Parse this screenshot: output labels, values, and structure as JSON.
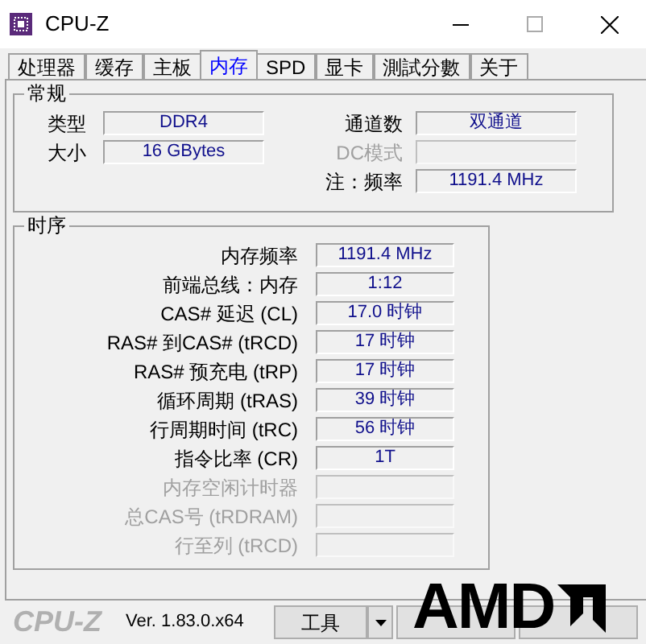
{
  "window": {
    "title": "CPU-Z"
  },
  "tabs": [
    {
      "label": "处理器",
      "selected": false
    },
    {
      "label": "缓存",
      "selected": false
    },
    {
      "label": "主板",
      "selected": false
    },
    {
      "label": "内存",
      "selected": true
    },
    {
      "label": "SPD",
      "selected": false
    },
    {
      "label": "显卡",
      "selected": false
    },
    {
      "label": "測試分數",
      "selected": false
    },
    {
      "label": "关于",
      "selected": false
    }
  ],
  "general": {
    "title": "常规",
    "left": [
      {
        "label": "类型",
        "value": "DDR4",
        "disabled": false
      },
      {
        "label": "大小",
        "value": "16 GBytes",
        "disabled": false
      }
    ],
    "right": [
      {
        "label": "通道数",
        "value": "双通道",
        "disabled": false
      },
      {
        "label": "DC模式",
        "disabled": true
      },
      {
        "label": "注：频率",
        "value": "1191.4 MHz",
        "disabled": false
      }
    ]
  },
  "timings": {
    "title": "时序",
    "rows": [
      {
        "label": "内存频率",
        "value": "1191.4 MHz",
        "disabled": false
      },
      {
        "label": "前端总线：内存",
        "value": "1:12",
        "disabled": false
      },
      {
        "label": "CAS# 延迟 (CL)",
        "value": "17.0 时钟",
        "disabled": false
      },
      {
        "label": "RAS# 到CAS# (tRCD)",
        "value": "17 时钟",
        "disabled": false
      },
      {
        "label": "RAS# 预充电 (tRP)",
        "value": "17 时钟",
        "disabled": false
      },
      {
        "label": "循环周期 (tRAS)",
        "value": "39 时钟",
        "disabled": false
      },
      {
        "label": "行周期时间 (tRC)",
        "value": "56 时钟",
        "disabled": false
      },
      {
        "label": "指令比率 (CR)",
        "value": "1T",
        "disabled": false
      },
      {
        "label": "内存空闲计时器",
        "disabled": true
      },
      {
        "label": "总CAS号 (tRDRAM)",
        "disabled": true
      },
      {
        "label": "行至列 (tRCD)",
        "disabled": true
      }
    ]
  },
  "footer": {
    "logo": "CPU-Z",
    "version": "Ver. 1.83.0.x64",
    "buttons": [
      {
        "label": "工具",
        "kind": "dropdown"
      },
      {
        "kind": "plain"
      },
      {
        "kind": "plain"
      }
    ]
  },
  "overlay_logo": {
    "text": "AMD"
  }
}
